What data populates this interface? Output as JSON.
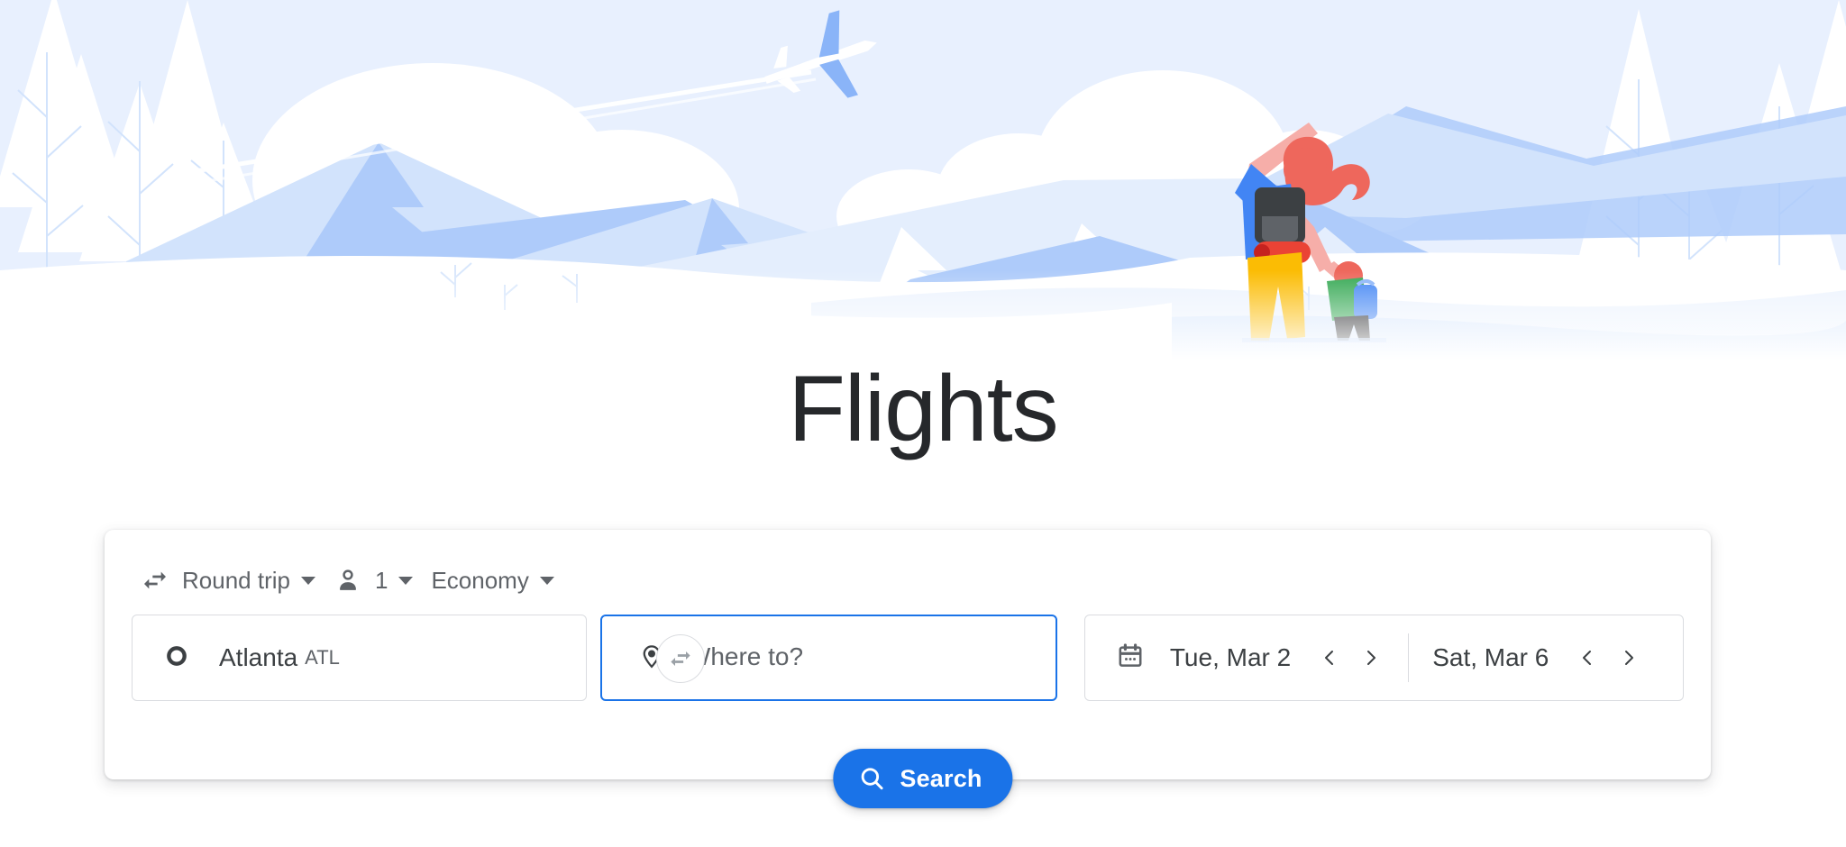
{
  "page": {
    "title": "Flights"
  },
  "hero": {
    "illustration_name": "snowy-mountains-hikers",
    "colors": {
      "sky": "#e8f0fe",
      "mountain_light": "#d2e3fc",
      "mountain_mid": "#aecbfa",
      "snow": "#ffffff",
      "plane_body": "#ffffff",
      "plane_wing": "#8ab4f8",
      "adult_hair": "#ee675c",
      "adult_jacket": "#4285f4",
      "adult_pants": "#fbbc04",
      "adult_backpack": "#3c4043",
      "adult_bedroll": "#ea4335",
      "adult_skin": "#f6aea9",
      "child_jacket": "#34a853",
      "child_pants": "#202124",
      "child_backpack": "#4285f4",
      "child_hair": "#ee675c"
    }
  },
  "toolbar": {
    "trip_type": {
      "icon": "swap-horizontal-icon",
      "label": "Round trip"
    },
    "passengers": {
      "icon": "person-icon",
      "count": "1"
    },
    "cabin_class": {
      "label": "Economy"
    }
  },
  "search_form": {
    "origin": {
      "icon": "circle-outline-icon",
      "city": "Atlanta",
      "code": "ATL"
    },
    "swap": {
      "icon": "swap-arrows-icon",
      "label": "Swap origin and destination"
    },
    "destination": {
      "icon": "map-pin-icon",
      "value": "",
      "placeholder": "Where to?",
      "focused": true,
      "focus_color": "#1a73e8"
    },
    "dates": {
      "icon": "calendar-icon",
      "departure": {
        "label": "Tue, Mar 2",
        "prev_icon": "chevron-left-icon",
        "next_icon": "chevron-right-icon"
      },
      "return": {
        "label": "Sat, Mar 6",
        "prev_icon": "chevron-left-icon",
        "next_icon": "chevron-right-icon"
      }
    },
    "search_button": {
      "icon": "search-icon",
      "label": "Search",
      "color": "#1a73e8"
    }
  }
}
